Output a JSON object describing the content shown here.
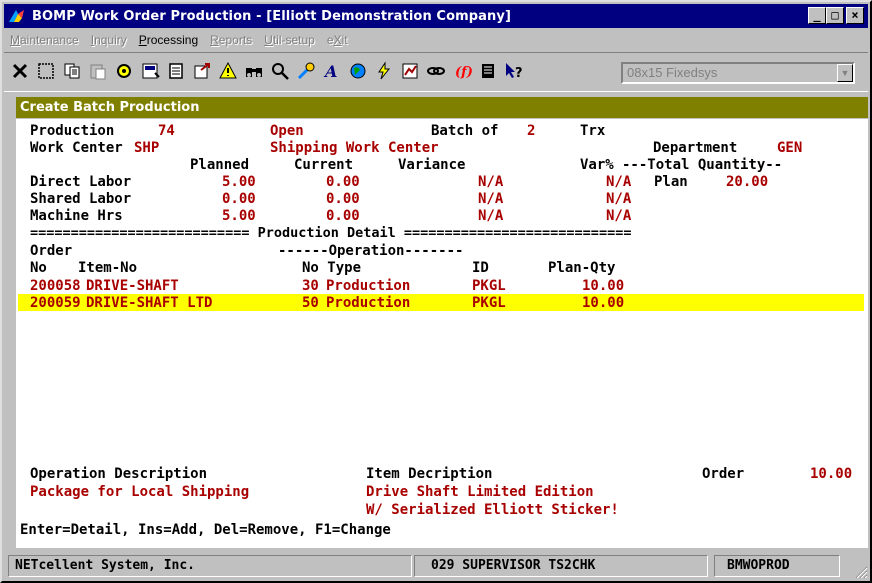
{
  "window": {
    "title": "BOMP Work Order Production - [Elliott Demonstration Company]",
    "controls": {
      "minimize": "_",
      "maximize": "□",
      "close": "×"
    }
  },
  "menu": [
    "Maintenance",
    "Inquiry",
    "Processing",
    "Reports",
    "Util-setup",
    "eXit"
  ],
  "toolbar": {
    "icons": [
      "close-x-icon",
      "select-icon",
      "copy-icon",
      "paste-icon",
      "settings-icon",
      "properties-icon",
      "list-icon",
      "export-icon",
      "warning-icon",
      "find-icon",
      "zoom-icon",
      "tool-icon",
      "font-icon",
      "globe-icon",
      "lightning-icon",
      "chart-icon",
      "link-icon",
      "function-icon",
      "notes-icon",
      "help-icon"
    ],
    "font_selector": "08x15 Fixedsys"
  },
  "panel_title": "Create Batch Production",
  "header": {
    "production_label": "Production",
    "production_no": "74",
    "status": "Open",
    "batch_label": "Batch of",
    "batch_count": "2",
    "trx_label": "Trx",
    "work_center_label": "Work Center",
    "work_center_code": "SHP",
    "work_center_name": "Shipping Work Center",
    "department_label": "Department",
    "department_code": "GEN"
  },
  "summary": {
    "col_planned": "Planned",
    "col_current": "Current",
    "col_variance": "Variance",
    "col_varpct": "Var%",
    "total_qty_header": "---Total Quantity--",
    "plan_label": "Plan",
    "plan_qty": "20.00",
    "rows": [
      {
        "label": "Direct Labor",
        "planned": "5.00",
        "current": "0.00",
        "variance": "N/A",
        "varpct": "N/A"
      },
      {
        "label": "Shared Labor",
        "planned": "0.00",
        "current": "0.00",
        "variance": "N/A",
        "varpct": "N/A"
      },
      {
        "label": "Machine Hrs",
        "planned": "5.00",
        "current": "0.00",
        "variance": "N/A",
        "varpct": "N/A"
      }
    ]
  },
  "detail": {
    "divider": "=========================== Production Detail ============================",
    "hdr_order": "Order",
    "hdr_operation": "------Operation-------",
    "hdr_no": "No",
    "hdr_item": "Item-No",
    "hdr_opno_type": "No Type",
    "hdr_id": "ID",
    "hdr_planqty": "Plan-Qty",
    "rows": [
      {
        "order": "200058",
        "item": "DRIVE-SHAFT",
        "op_no": "30",
        "op_type": "Production",
        "id": "PKGL",
        "plan_qty": "10.00"
      },
      {
        "order": "200059",
        "item": "DRIVE-SHAFT LTD",
        "op_no": "50",
        "op_type": "Production",
        "id": "PKGL",
        "plan_qty": "10.00"
      }
    ]
  },
  "footer": {
    "op_desc_label": "Operation Description",
    "op_desc_value": "Package for Local Shipping",
    "item_desc_label": "Item Decription",
    "item_desc_line1": "Drive Shaft Limited Edition",
    "item_desc_line2": "W/ Serialized Elliott Sticker!",
    "order_label": "Order",
    "order_qty": "10.00",
    "hints": "Enter=Detail, Ins=Add, Del=Remove, F1=Change"
  },
  "statusbar": {
    "company": "NETcellent System, Inc.",
    "session": "029 SUPERVISOR TS2CHK",
    "program": "BMWOPROD"
  }
}
